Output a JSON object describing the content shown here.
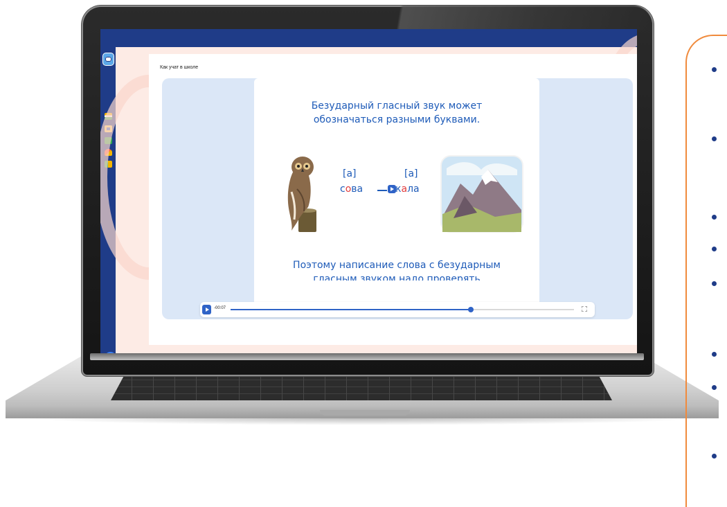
{
  "app": {
    "breadcrumb": "Как учат в школе",
    "sidebar": {
      "items": [
        {
          "icon": "books-icon"
        },
        {
          "icon": "board-icon"
        },
        {
          "icon": "book-icon"
        },
        {
          "icon": "graduation-cap-icon"
        },
        {
          "icon": "folder-icon"
        }
      ],
      "back_icon": "arrow-left-icon",
      "back_glyph": "←"
    },
    "slide": {
      "heading_line1": "Безударный гласный звук может",
      "heading_line2": "обозначаться разными буквами.",
      "phonetic1": "[а]",
      "phonetic2": "[а]",
      "word1_a": "с",
      "word1_vowel": "о",
      "word1_b": "ва",
      "word2_a": "",
      "word2_rest_a": "к",
      "word2_vowel": "а",
      "word2_rest_b": "ла",
      "footer_line1": "Поэтому написание слова с безударным",
      "footer_line2": "гласным звуком надо проверять"
    },
    "player": {
      "time": "-00:07",
      "progress": 0.7
    }
  },
  "colors": {
    "accent": "#1f3c88",
    "slide_text": "#1e5bb8",
    "highlight": "#e23b3b",
    "panel_border": "#f08a3c"
  }
}
